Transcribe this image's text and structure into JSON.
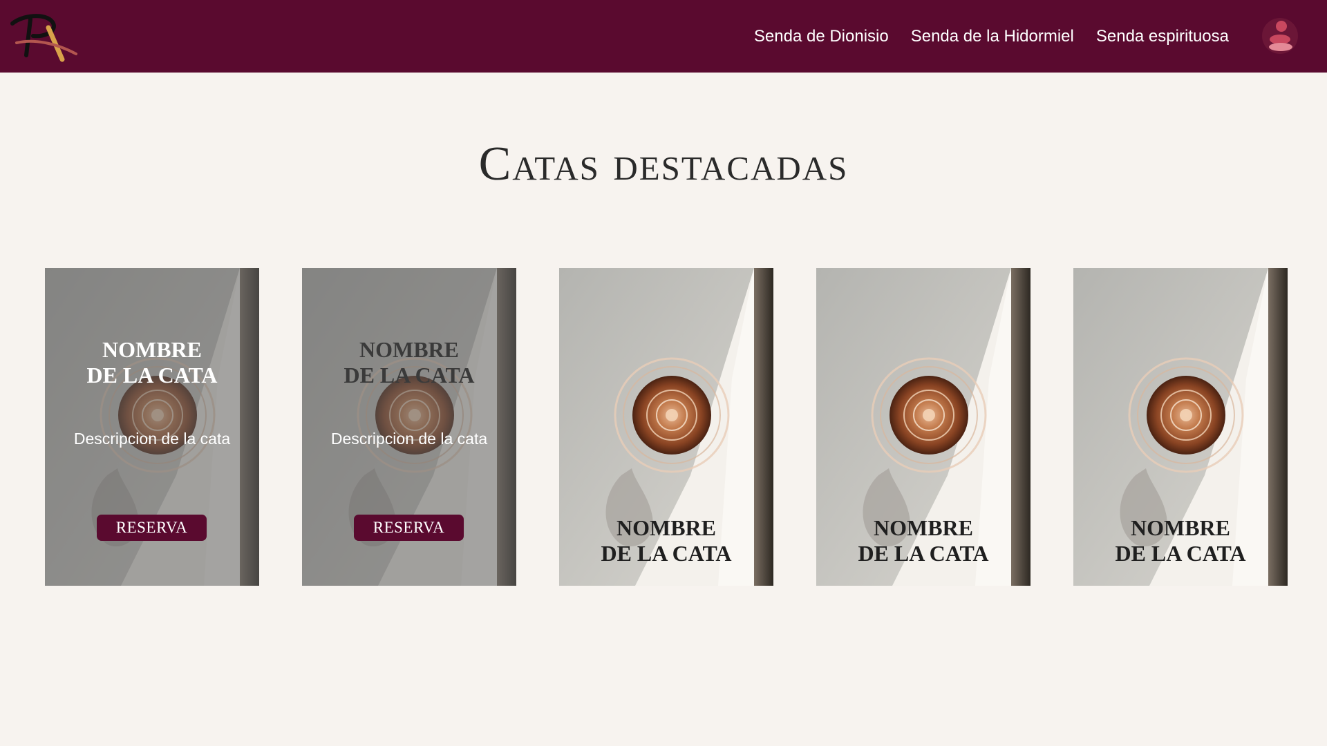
{
  "header": {
    "nav": [
      {
        "label": "Senda de Dionisio"
      },
      {
        "label": "Senda de la Hidormiel"
      },
      {
        "label": "Senda espirituosa"
      }
    ],
    "brand_color": "#5a0a2f",
    "logo_icon": "brand-logo",
    "user_icon": "user-icon"
  },
  "section": {
    "title": "Catas destacadas"
  },
  "cards": [
    {
      "name_line1": "NOMBRE",
      "name_line2": "DE LA CATA",
      "description": "Descripcion de la cata",
      "button": "RESERVA",
      "state": "hover"
    },
    {
      "name_line1": "NOMBRE",
      "name_line2": "DE LA CATA",
      "description": "Descripcion de la cata",
      "button": "RESERVA",
      "state": "hover"
    },
    {
      "name_line1": "NOMBRE",
      "name_line2": "DE LA CATA",
      "state": "default"
    },
    {
      "name_line1": "NOMBRE",
      "name_line2": "DE LA CATA",
      "state": "default"
    },
    {
      "name_line1": "NOMBRE",
      "name_line2": "DE LA CATA",
      "state": "default"
    }
  ]
}
